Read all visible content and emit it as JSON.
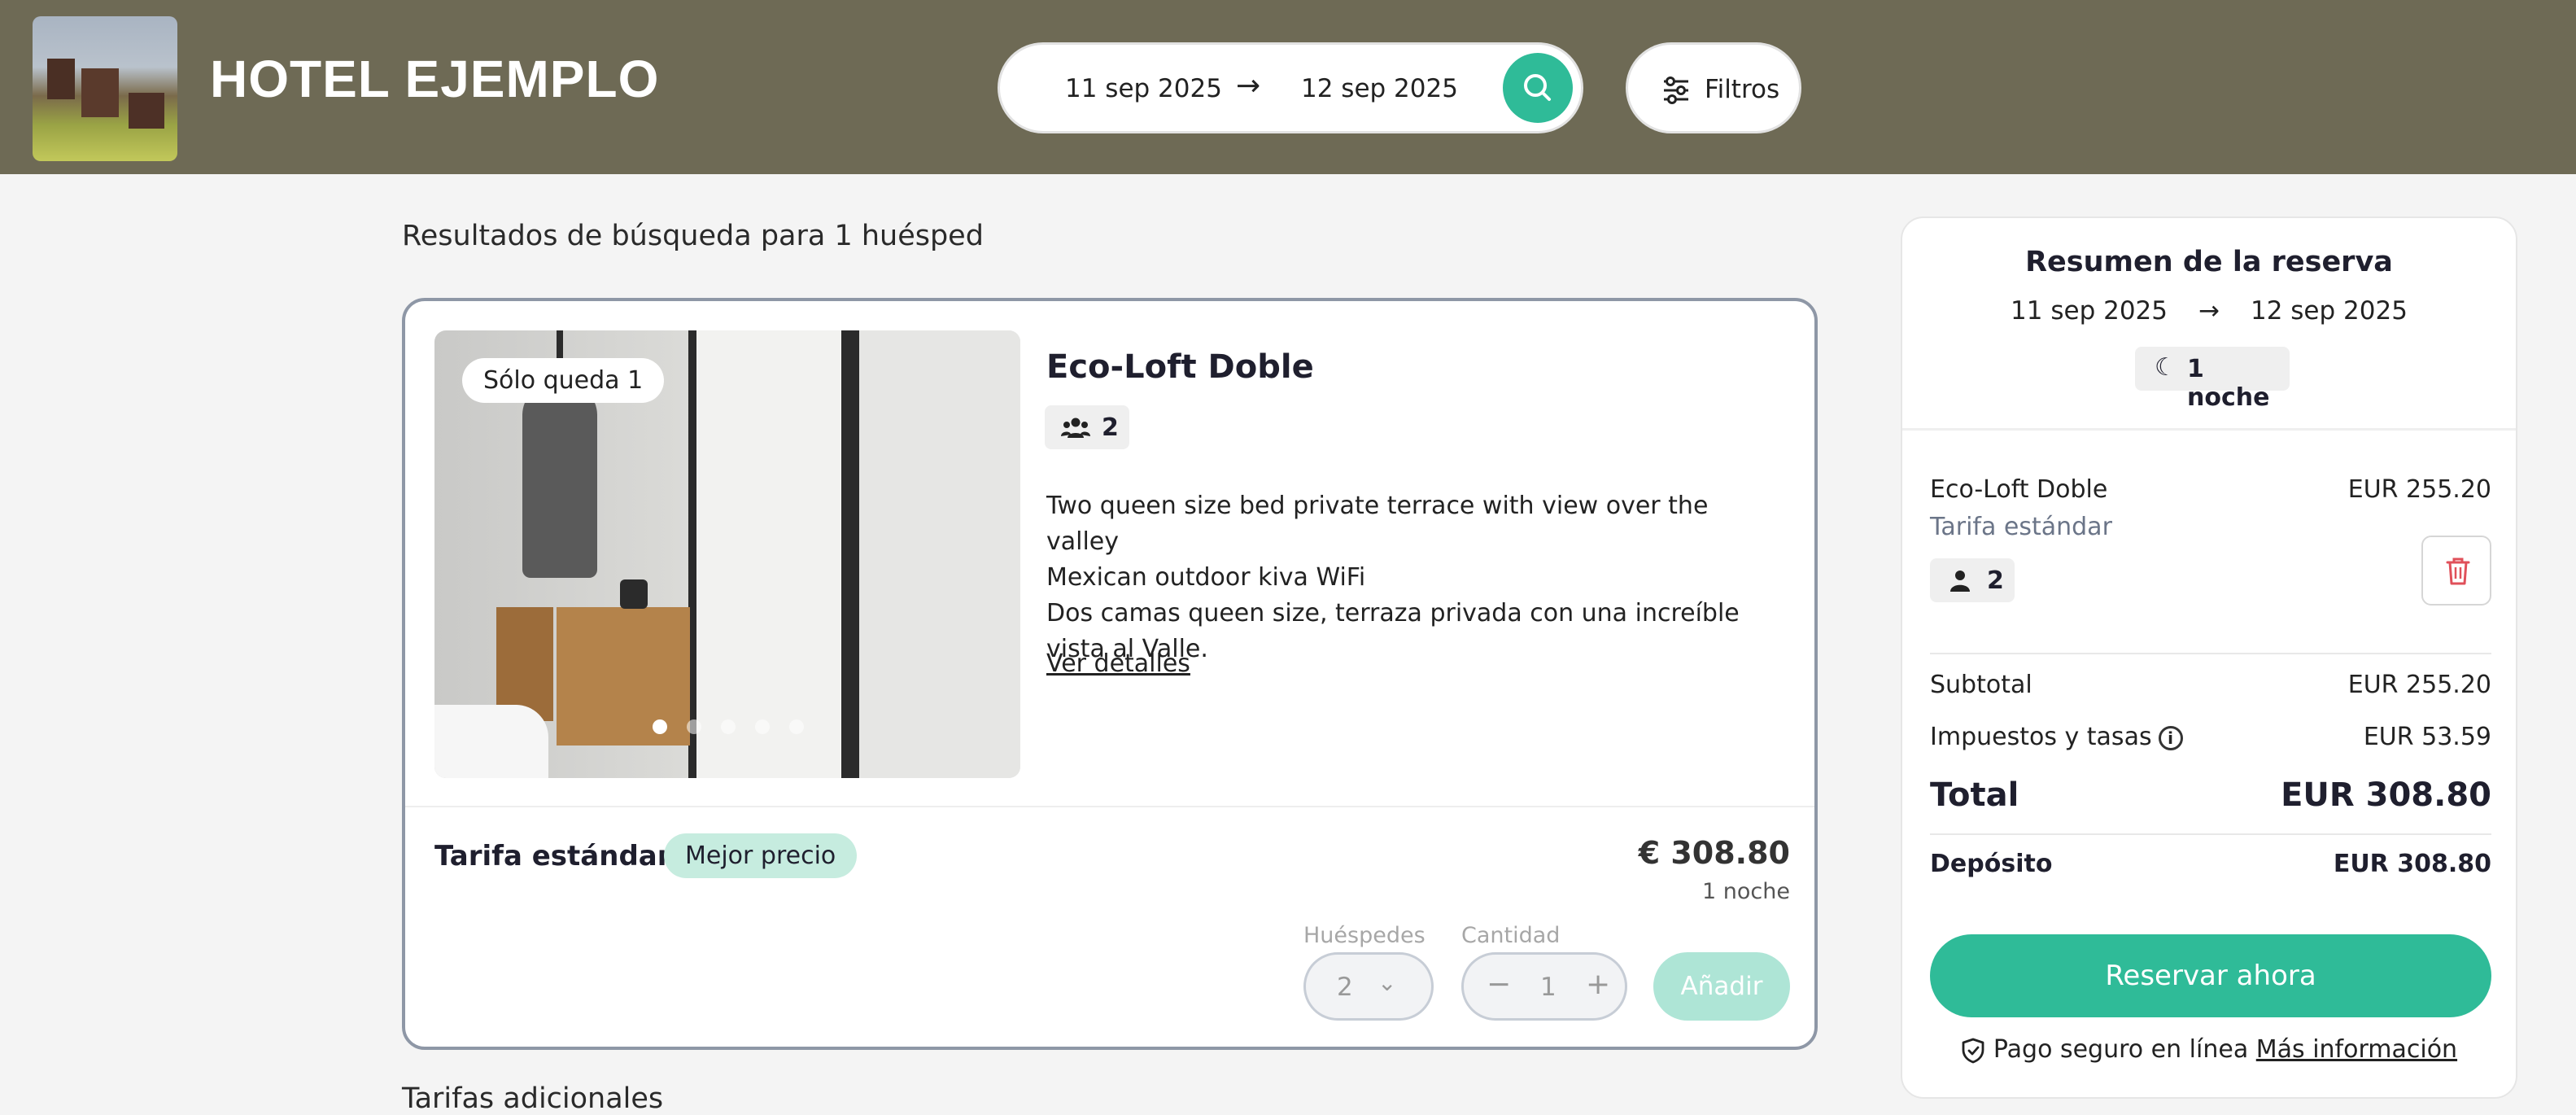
{
  "header": {
    "hotel_name": "HOTEL EJEMPLO",
    "check_in": "11 sep 2025",
    "check_out": "12 sep 2025",
    "arrow": "→",
    "filters_label": "Filtros"
  },
  "results": {
    "title": "Resultados de búsqueda para 1 huésped",
    "below_text": "Tarifas adicionales"
  },
  "room": {
    "availability_badge": "Sólo queda 1",
    "name": "Eco-Loft Doble",
    "capacity": "2",
    "description_lines": [
      "Two queen size bed private terrace with view over the valley",
      "Mexican outdoor kiva WiFi",
      "Dos camas queen size, terraza privada con una increíble",
      "vista al Valle."
    ],
    "details_link": "Ver detalles",
    "photo_dots": 5,
    "active_dot": 0
  },
  "rate": {
    "name": "Tarifa estándar",
    "badge": "Mejor precio",
    "price": "€ 308.80",
    "nights": "1 noche",
    "guests_label": "Huéspedes",
    "guests_value": "2",
    "quantity_label": "Cantidad",
    "quantity_value": "1",
    "minus": "−",
    "plus": "+",
    "add_button": "Añadir"
  },
  "summary": {
    "title": "Resumen de la reserva",
    "check_in": "11 sep 2025",
    "check_out": "12 sep 2025",
    "arrow": "→",
    "nights": "1 noche",
    "item_name": "Eco-Loft Doble",
    "item_price": "EUR 255.20",
    "item_rate": "Tarifa estándar",
    "item_guests": "2",
    "subtotal_label": "Subtotal",
    "subtotal_value": "EUR 255.20",
    "taxes_label": "Impuestos y tasas",
    "taxes_value": "EUR 53.59",
    "total_label": "Total",
    "total_value": "EUR 308.80",
    "deposit_label": "Depósito",
    "deposit_value": "EUR 308.80",
    "book_button": "Reservar ahora",
    "secure_text": "Pago seguro en línea",
    "more_info_link": "Más información"
  },
  "colors": {
    "header_bg": "#6e6a55",
    "accent": "#2fbb98",
    "badge_green": "#c6ecdf",
    "delete_red": "#e0505a"
  },
  "icons": {
    "search": "search-icon",
    "filters": "sliders-icon",
    "guests": "users-icon",
    "person": "user-icon",
    "moon": "moon-icon",
    "trash": "trash-icon",
    "info": "info-icon",
    "shield": "shield-check-icon"
  }
}
